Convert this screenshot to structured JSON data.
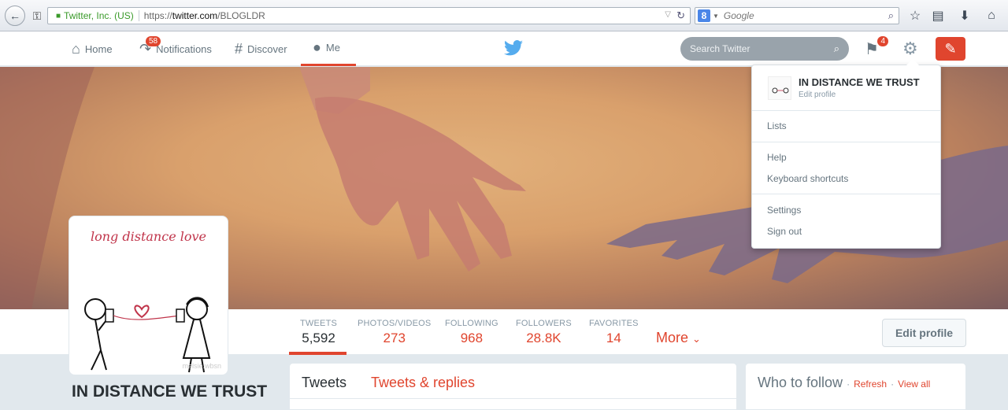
{
  "browser": {
    "site_identity": "Twitter, Inc. (US)",
    "url_prefix": "https://",
    "url_domain": "twitter.com",
    "url_path": "/BLOGLDR",
    "search_engine_letter": "8",
    "search_placeholder": "Google",
    "icons": [
      "back-arrow-icon",
      "key-icon",
      "lock-icon",
      "reload-icon",
      "magnifier-icon",
      "bookmark-star-icon",
      "clipboard-icon",
      "download-arrow-icon",
      "home-icon"
    ]
  },
  "topbar": {
    "nav": [
      {
        "label": "Home",
        "icon": "home-icon"
      },
      {
        "label": "Notifications",
        "icon": "notifications-icon",
        "badge": "58"
      },
      {
        "label": "Discover",
        "icon": "hashtag-icon"
      },
      {
        "label": "Me",
        "icon": "person-icon",
        "active": true
      }
    ],
    "search_placeholder": "Search Twitter",
    "dm_badge": "4",
    "accent_color": "#e0452e"
  },
  "profile": {
    "name": "IN DISTANCE WE TRUST",
    "avatar_caption": "long distance love",
    "avatar_watermark": "melsie.wbsn"
  },
  "stats": [
    {
      "label": "TWEETS",
      "value": "5,592",
      "active": true
    },
    {
      "label": "PHOTOS/VIDEOS",
      "value": "273"
    },
    {
      "label": "FOLLOWING",
      "value": "968"
    },
    {
      "label": "FOLLOWERS",
      "value": "28.8K"
    },
    {
      "label": "FAVORITES",
      "value": "14"
    }
  ],
  "more_label": "More",
  "edit_profile_label": "Edit profile",
  "tweets_tabs": {
    "tweets": "Tweets",
    "replies": "Tweets & replies"
  },
  "who_to_follow": {
    "title": "Who to follow",
    "refresh": "Refresh",
    "view_all": "View all",
    "separator": "·"
  },
  "dropdown": {
    "name": "IN DISTANCE WE TRUST",
    "edit_profile": "Edit profile",
    "items": [
      "Lists",
      "Help",
      "Keyboard shortcuts",
      "Settings",
      "Sign out"
    ]
  }
}
